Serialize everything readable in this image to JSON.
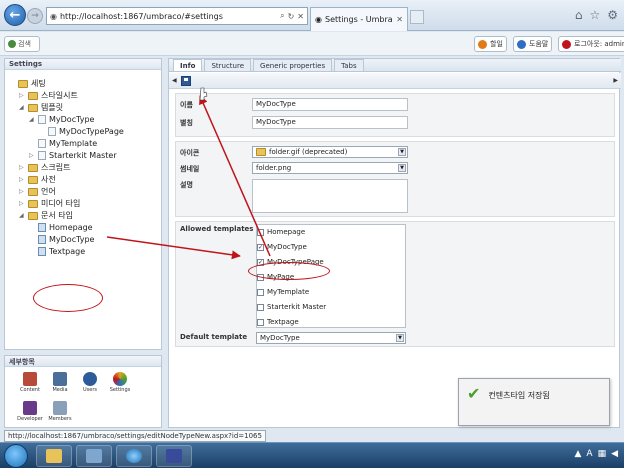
{
  "browser": {
    "url": "http://localhost:1867/umbraco/#settings",
    "tab_title": "Settings - Umbraco CMS -..."
  },
  "topbar": {
    "search_label": "검색",
    "buttons": [
      {
        "label": "할일",
        "color": "#e07b1a"
      },
      {
        "label": "도움말",
        "color": "#2e6fc4"
      },
      {
        "label": "로그아웃: admin",
        "color": "#c0141b"
      }
    ]
  },
  "tree": {
    "header": "Settings",
    "items": [
      {
        "label": "세팅",
        "kind": "folder",
        "indent": 0,
        "arrow": ""
      },
      {
        "label": "스타일시트",
        "kind": "folder",
        "indent": 1,
        "arrow": "▷"
      },
      {
        "label": "템플릿",
        "kind": "folder",
        "indent": 1,
        "arrow": "◢"
      },
      {
        "label": "MyDocType",
        "kind": "doc",
        "indent": 2,
        "arrow": "◢"
      },
      {
        "label": "MyDocTypePage",
        "kind": "doc",
        "indent": 3,
        "arrow": ""
      },
      {
        "label": "MyTemplate",
        "kind": "doc",
        "indent": 2,
        "arrow": ""
      },
      {
        "label": "Starterkit Master",
        "kind": "doc",
        "indent": 2,
        "arrow": "▷"
      },
      {
        "label": "스크립트",
        "kind": "folder",
        "indent": 1,
        "arrow": "▷"
      },
      {
        "label": "사전",
        "kind": "folder",
        "indent": 1,
        "arrow": "▷"
      },
      {
        "label": "언어",
        "kind": "folder",
        "indent": 1,
        "arrow": "▷"
      },
      {
        "label": "미디어 타입",
        "kind": "folder",
        "indent": 1,
        "arrow": "▷"
      },
      {
        "label": "문서 타입",
        "kind": "folder",
        "indent": 1,
        "arrow": "◢"
      },
      {
        "label": "Homepage",
        "kind": "docblue",
        "indent": 2,
        "arrow": ""
      },
      {
        "label": "MyDocType",
        "kind": "docblue",
        "indent": 2,
        "arrow": ""
      },
      {
        "label": "Textpage",
        "kind": "docblue",
        "indent": 2,
        "arrow": ""
      }
    ]
  },
  "sections": {
    "header": "세부항목",
    "items": [
      {
        "label": "Content",
        "color": "#b84a3a"
      },
      {
        "label": "Media",
        "color": "#4a6f9a"
      },
      {
        "label": "Users",
        "color": "#2e5c9a"
      },
      {
        "label": "Settings",
        "color": "#e0a020"
      },
      {
        "label": "Developer",
        "color": "#6a3a8a"
      },
      {
        "label": "Members",
        "color": "#8aa0b8"
      }
    ]
  },
  "status_url": "http://localhost:1867/umbraco/settings/editNodeTypeNew.aspx?id=1065",
  "tabs": [
    "Info",
    "Structure",
    "Generic properties",
    "Tabs"
  ],
  "form": {
    "name_label": "이름",
    "name_value": "MyDocType",
    "alias_label": "별칭",
    "alias_value": "MyDocType",
    "icon_label": "아이콘",
    "icon_value": "folder.gif (deprecated)",
    "thumb_label": "썸네일",
    "thumb_value": "folder.png",
    "desc_label": "설명",
    "allowed_label": "Allowed templates",
    "templates": [
      {
        "label": "Homepage",
        "checked": false
      },
      {
        "label": "MyDocType",
        "checked": true
      },
      {
        "label": "MyDocTypePage",
        "checked": true
      },
      {
        "label": "MyPage",
        "checked": false
      },
      {
        "label": "MyTemplate",
        "checked": false
      },
      {
        "label": "Starterkit Master",
        "checked": false
      },
      {
        "label": "Textpage",
        "checked": false
      }
    ],
    "default_label": "Default template",
    "default_value": "MyDocType"
  },
  "toast": {
    "message": "컨텐츠타입 저장됨"
  },
  "colors": {
    "annotation": "#c0141b"
  }
}
